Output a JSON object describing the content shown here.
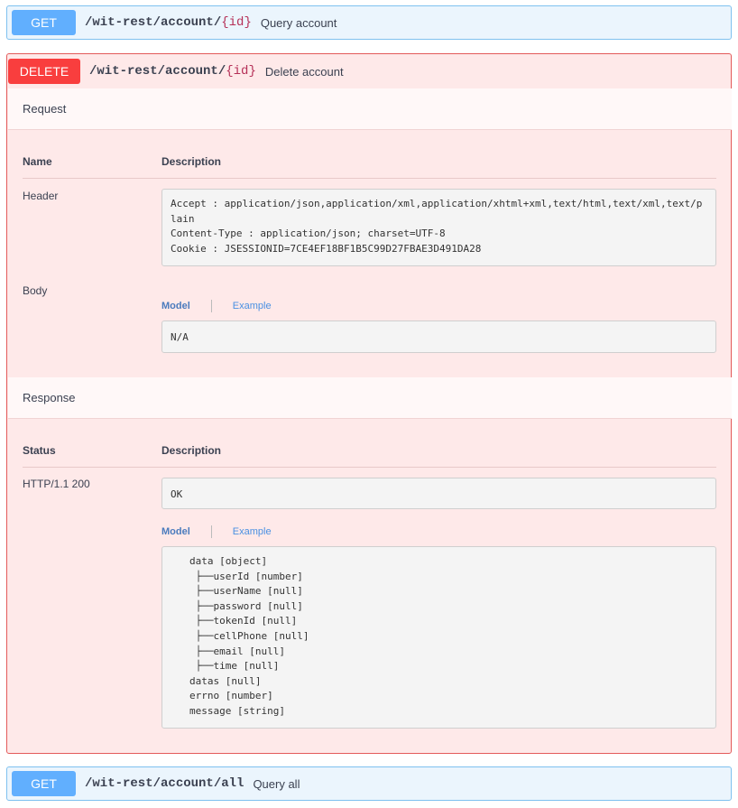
{
  "operations": {
    "query_account": {
      "method": "GET",
      "path_base": "/wit-rest/account/",
      "path_param": "{id}",
      "summary": "Query account"
    },
    "delete_account": {
      "method": "DELETE",
      "path_base": "/wit-rest/account/",
      "path_param": "{id}",
      "summary": "Delete account"
    },
    "query_all": {
      "method": "GET",
      "path_base": "/wit-rest/account/all",
      "summary": "Query all"
    }
  },
  "request": {
    "title": "Request",
    "col_name": "Name",
    "col_description": "Description",
    "header_label": "Header",
    "header_value": "Accept : application/json,application/xml,application/xhtml+xml,text/html,text/xml,text/plain\nContent-Type : application/json; charset=UTF-8\nCookie : JSESSIONID=7CE4EF18BF1B5C99D27FBAE3D491DA28",
    "body_label": "Body",
    "tab_model": "Model",
    "tab_example": "Example",
    "body_value": "N/A"
  },
  "response": {
    "title": "Response",
    "col_status": "Status",
    "col_description": "Description",
    "status_label": "HTTP/1.1 200",
    "status_value": "OK",
    "tab_model": "Model",
    "tab_example": "Example",
    "model_tree": "data [object]\n ├──userId [number]\n ├──userName [null]\n ├──password [null]\n ├──tokenId [null]\n ├──cellPhone [null]\n ├──email [null]\n ├──time [null]\ndatas [null]\nerrno [number]\nmessage [string]"
  },
  "colors": {
    "get": "#61affe",
    "delete": "#f93e3e",
    "get_bg": "#ebf5fd",
    "delete_bg": "#fee9e9"
  }
}
